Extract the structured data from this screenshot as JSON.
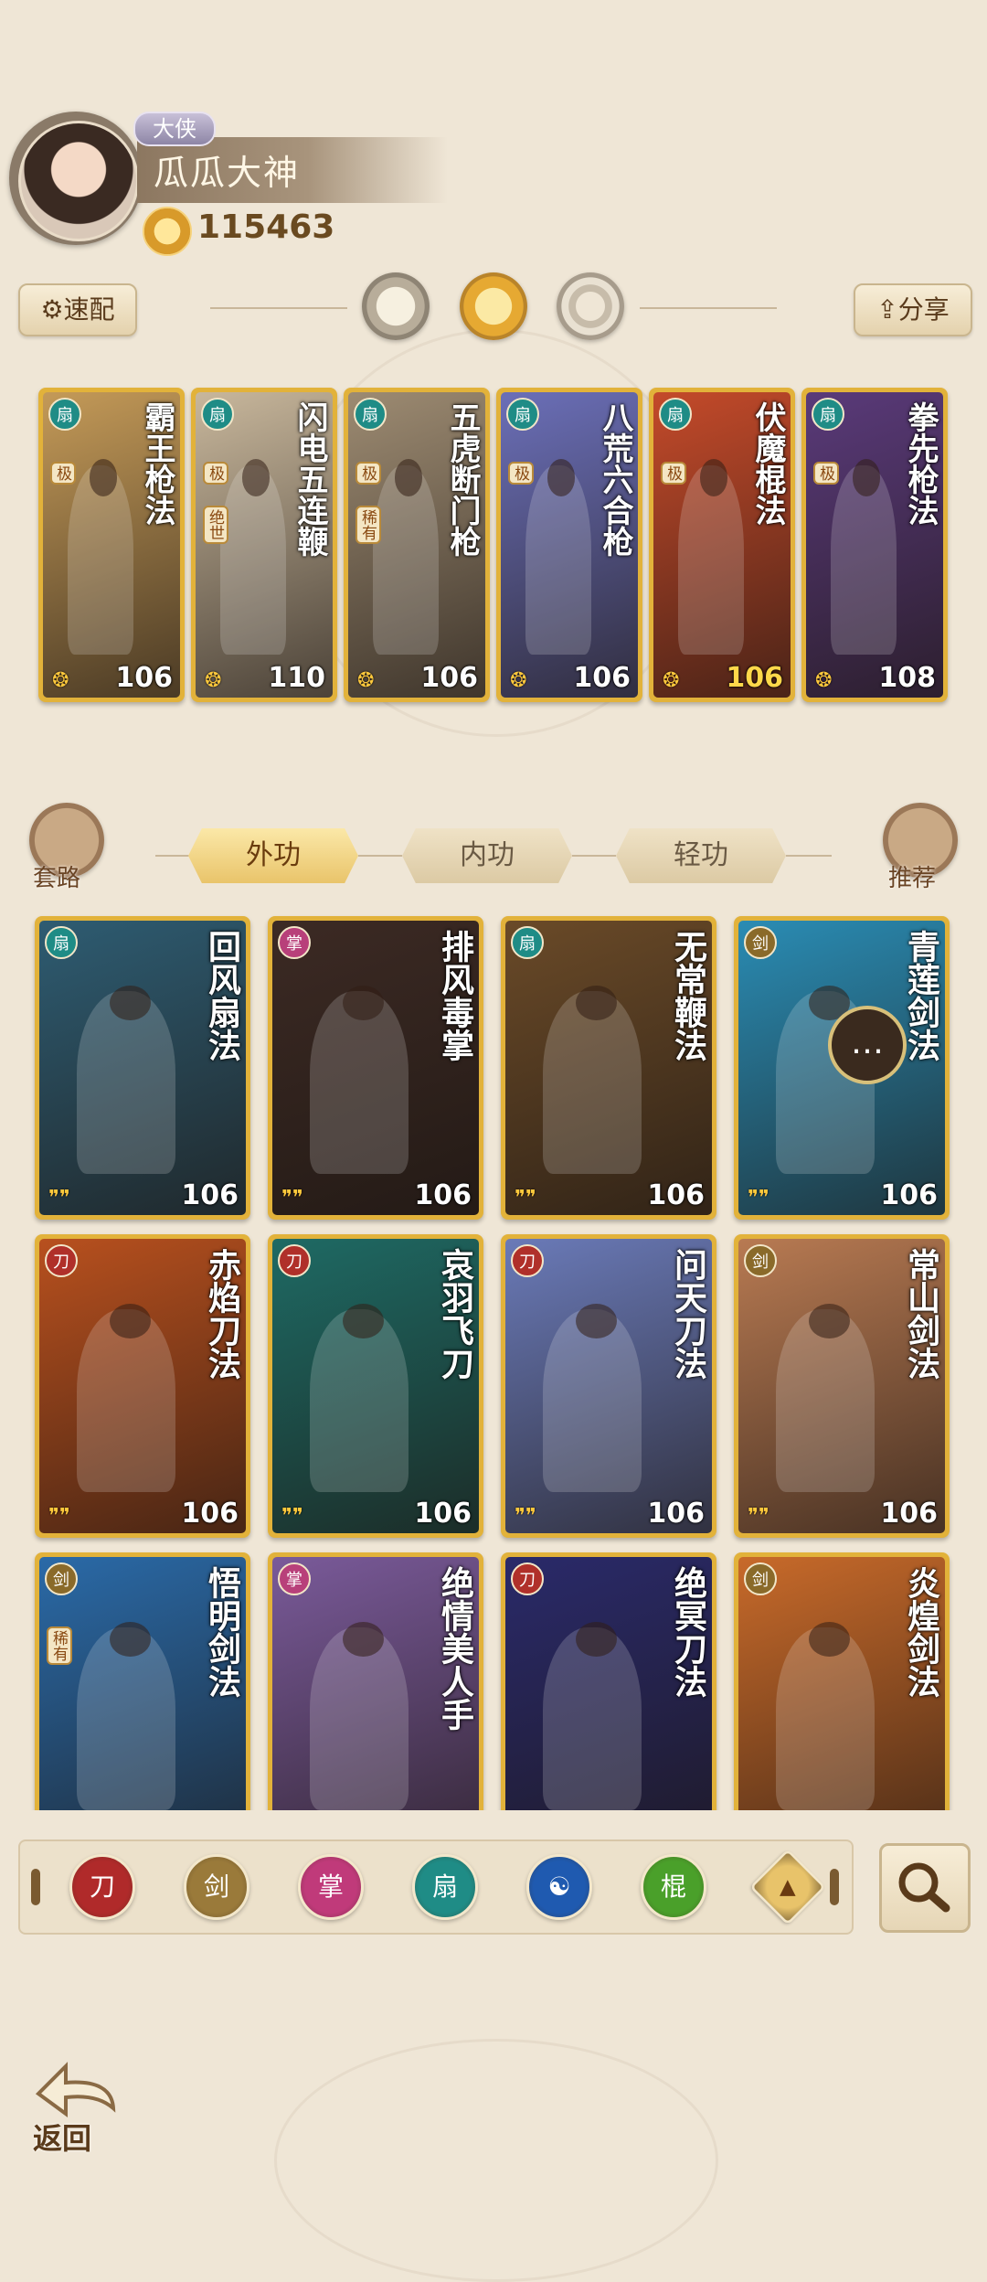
{
  "player": {
    "rank": "大侠",
    "name": "瓜瓜大神",
    "power": "115463"
  },
  "toolbar": {
    "quick_config": "速配",
    "share": "分享"
  },
  "equipped": [
    {
      "name": "霸王枪法",
      "grade": "极",
      "level": "106",
      "type": "fan",
      "color": "#1f8c86",
      "bg": "#c49a58",
      "level_gold": false
    },
    {
      "name": "闪电五连鞭",
      "grade": "极",
      "grade2": "绝世",
      "level": "110",
      "type": "fan",
      "color": "#1f8c86",
      "bg": "#c8b79c",
      "level_gold": false
    },
    {
      "name": "五虎断门枪",
      "grade": "极",
      "grade2": "稀有",
      "level": "106",
      "type": "fan",
      "color": "#1f8c86",
      "bg": "#9d8b72",
      "level_gold": false
    },
    {
      "name": "八荒六合枪",
      "grade": "极",
      "level": "106",
      "type": "fan",
      "color": "#1f8c86",
      "bg": "#6b6fb8",
      "level_gold": false
    },
    {
      "name": "伏魔棍法",
      "grade": "极",
      "level": "106",
      "type": "fan",
      "color": "#1f8c86",
      "bg": "#c44a2a",
      "level_gold": true
    },
    {
      "name": "拳先枪法",
      "grade": "极",
      "level": "108",
      "type": "fan",
      "color": "#1f8c86",
      "bg": "#5a3a7a",
      "level_gold": false
    }
  ],
  "tabs": [
    "外功",
    "内功",
    "轻功"
  ],
  "side": {
    "left": "套路",
    "right": "推荐"
  },
  "skills": [
    {
      "name": "回风扇法",
      "level": "106",
      "type": "fan",
      "color": "#1f8c86",
      "bg": "#2e5c72"
    },
    {
      "name": "排风毒掌",
      "level": "106",
      "type": "palm",
      "color": "#b8407a",
      "bg": "#3c2a24"
    },
    {
      "name": "无常鞭法",
      "level": "106",
      "type": "fan",
      "color": "#1f8c86",
      "bg": "#6a4a28"
    },
    {
      "name": "青莲剑法",
      "level": "106",
      "type": "sword",
      "color": "#8a6a2a",
      "bg": "#2a8cb4"
    },
    {
      "name": "赤焰刀法",
      "level": "106",
      "type": "blade",
      "color": "#b0302a",
      "bg": "#b8501e"
    },
    {
      "name": "哀羽飞刀",
      "level": "106",
      "type": "blade",
      "color": "#b0302a",
      "bg": "#1e6a64"
    },
    {
      "name": "问天刀法",
      "level": "106",
      "type": "blade",
      "color": "#b0302a",
      "bg": "#6a7ab8"
    },
    {
      "name": "常山剑法",
      "level": "106",
      "type": "sword",
      "color": "#8a6a2a",
      "bg": "#b87a52"
    },
    {
      "name": "悟明剑法",
      "level": "",
      "grade": "稀有",
      "type": "sword",
      "color": "#8a6a2a",
      "bg": "#2a6aa8"
    },
    {
      "name": "绝情美人手",
      "level": "",
      "type": "palm",
      "color": "#b8407a",
      "bg": "#7a5a9a"
    },
    {
      "name": "绝冥刀法",
      "level": "",
      "type": "blade",
      "color": "#b0302a",
      "bg": "#2a2a6a"
    },
    {
      "name": "炎煌剑法",
      "level": "",
      "type": "sword",
      "color": "#8a6a2a",
      "bg": "#c86a2a"
    }
  ],
  "filters": [
    {
      "name": "blade-filter-icon",
      "color": "#b02a2a",
      "glyph": "刀"
    },
    {
      "name": "sword-filter-icon",
      "color": "#9a7a3a",
      "glyph": "剑"
    },
    {
      "name": "palm-filter-icon",
      "color": "#c03a7a",
      "glyph": "掌"
    },
    {
      "name": "fan-filter-icon",
      "color": "#1f8c86",
      "glyph": "扇"
    },
    {
      "name": "yinyang-filter-icon",
      "color": "#1f5ab0",
      "glyph": "☯"
    },
    {
      "name": "staff-filter-icon",
      "color": "#4aa02a",
      "glyph": "棍"
    },
    {
      "name": "spear-filter-icon",
      "color": "#e8c36a",
      "glyph": "▲"
    }
  ],
  "bottom": {
    "back": "返回"
  }
}
